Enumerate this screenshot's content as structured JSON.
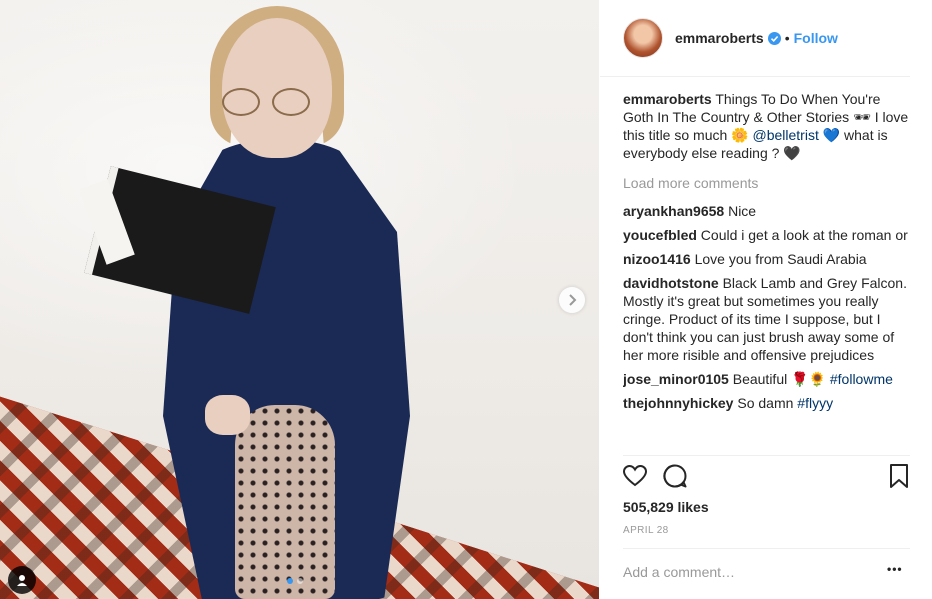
{
  "post": {
    "username": "emmaroberts",
    "follow_label": "Follow",
    "bullet": "•",
    "caption": {
      "user": "emmaroberts",
      "text_1": "Things To Do When You're Goth In The Country & Other Stories 🕶 I love this title so much 🌼",
      "mention": "@belletrist",
      "text_2": "💙 what is everybody else reading ? 🖤"
    },
    "load_more": "Load more comments",
    "comments": [
      {
        "user": "aryankhan9658",
        "text": "Nice"
      },
      {
        "user": "youcefbled",
        "text": "Could i get a look at the roman or"
      },
      {
        "user": "nizoo1416",
        "text": "Love you from Saudi Arabia"
      },
      {
        "user": "davidhotstone",
        "text": "Black Lamb and Grey Falcon. Mostly it's great but sometimes you really cringe. Product of its time I suppose, but I don't think you can just brush away some of her more risible and offensive prejudices"
      },
      {
        "user": "jose_minor0105",
        "text": "Beautiful 🌹🌻",
        "tag": "#followme"
      },
      {
        "user": "thejohnnyhickey",
        "text": "So damn",
        "tag": "#flyyy"
      }
    ],
    "likes": "505,829 likes",
    "date": "APRIL 28",
    "add_comment_placeholder": "Add a comment…",
    "more_label": "•••"
  },
  "icons": {
    "like": "heart-icon",
    "comment": "comment-icon",
    "save": "bookmark-icon",
    "next": "chevron-right-icon",
    "verified": "verified-badge-icon",
    "user_tag": "user-tag-icon"
  },
  "colors": {
    "accent": "#3897f0",
    "muted": "#999999",
    "text": "#262626"
  },
  "carousel": {
    "count": 2,
    "active": 1
  }
}
